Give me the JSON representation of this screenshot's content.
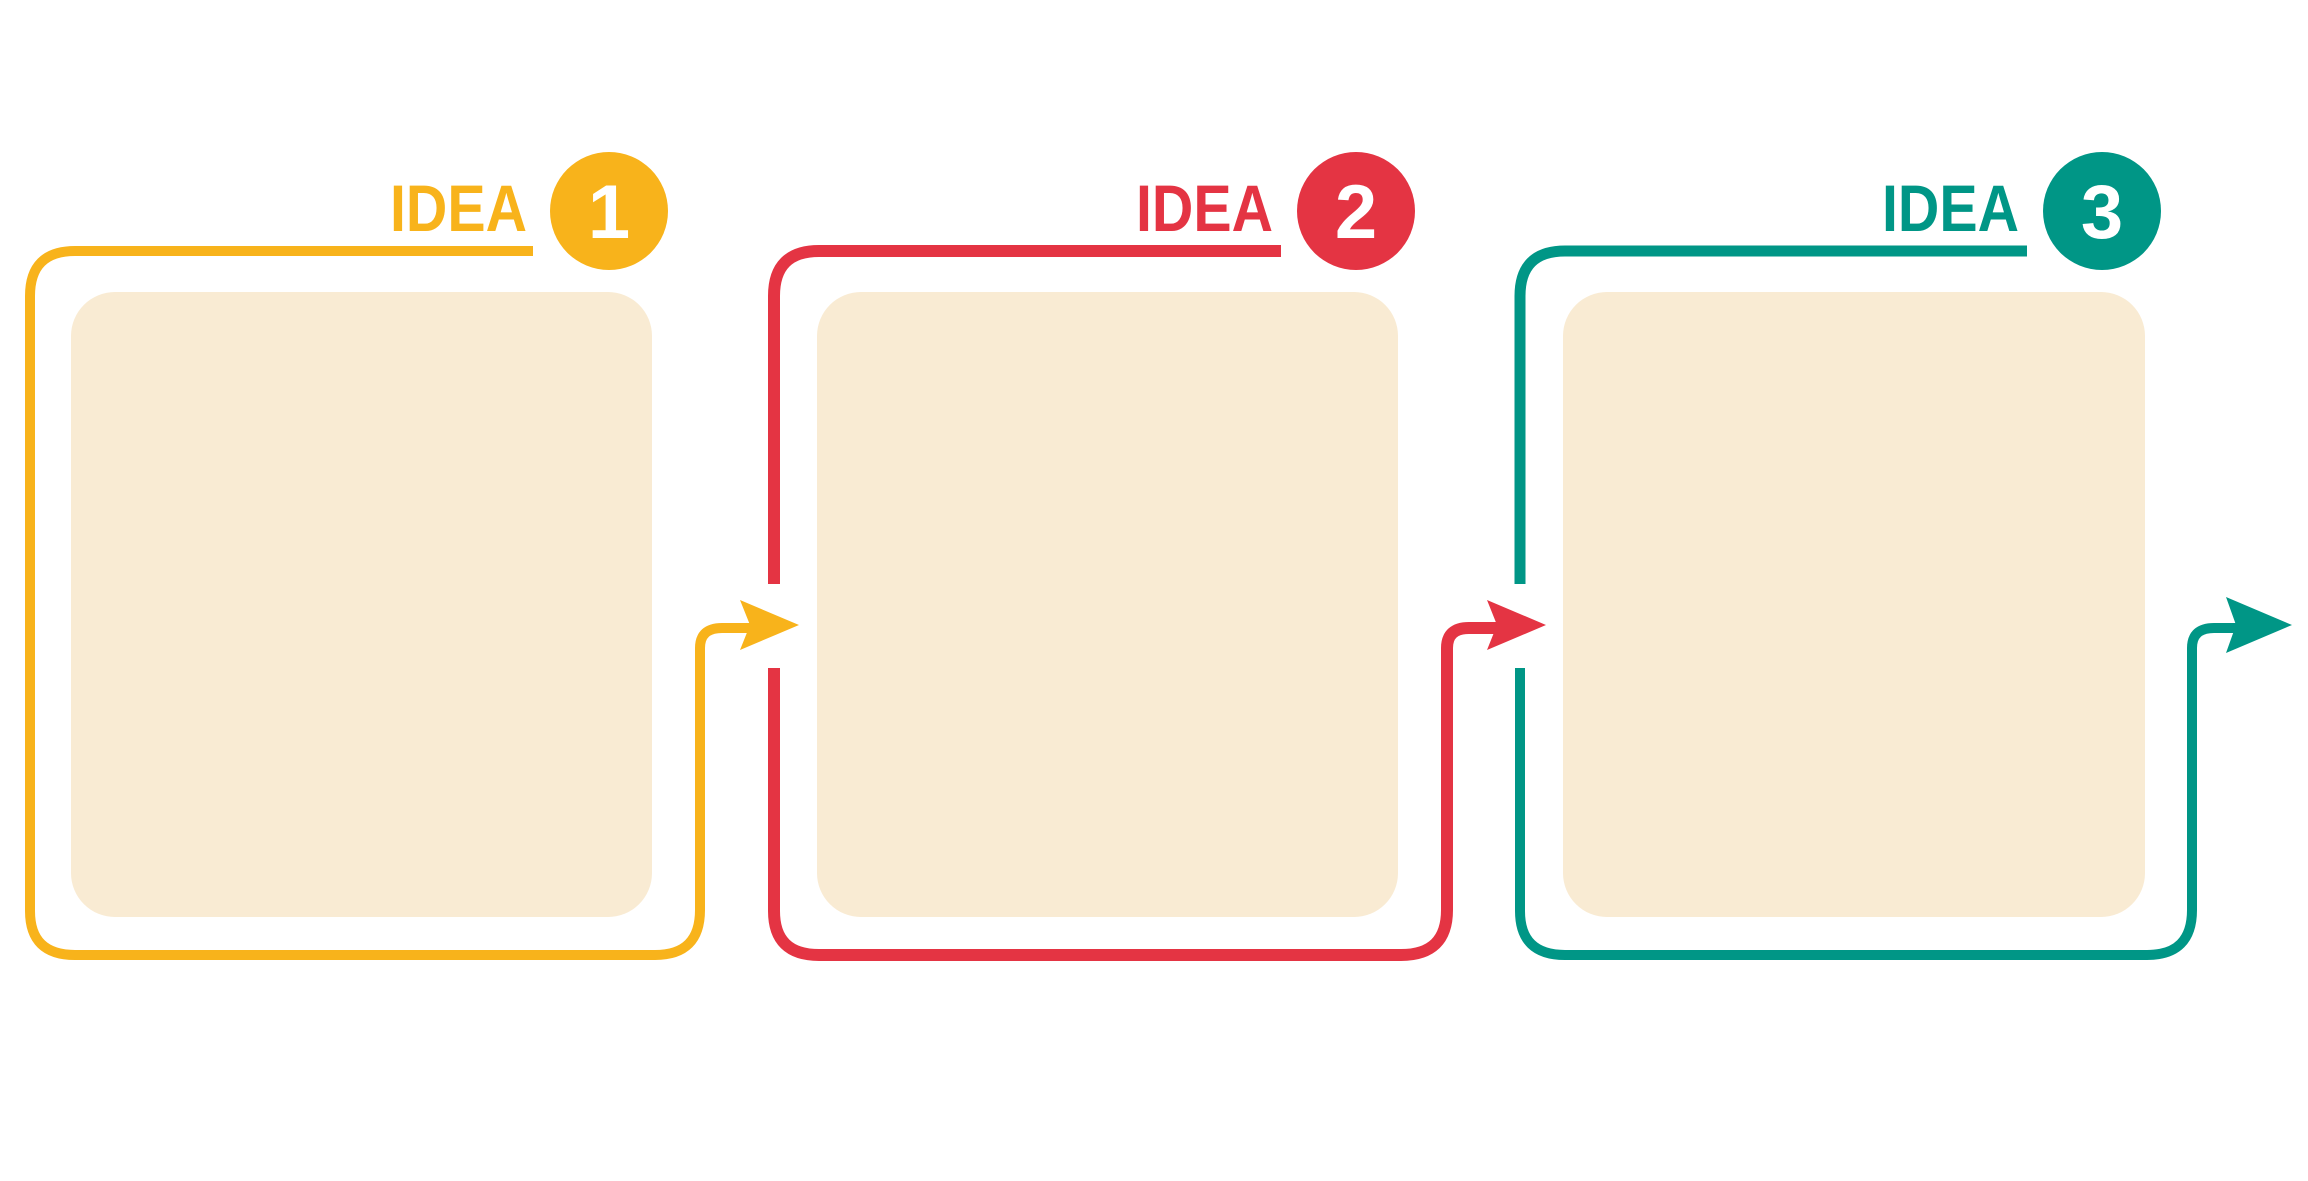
{
  "colors": {
    "idea1": "#F8B31B",
    "idea2": "#E43443",
    "idea3": "#009686",
    "card_fill": "#F9EBD3"
  },
  "ideas": [
    {
      "label": "IDEA",
      "number": "1"
    },
    {
      "label": "IDEA",
      "number": "2"
    },
    {
      "label": "IDEA",
      "number": "3"
    }
  ]
}
